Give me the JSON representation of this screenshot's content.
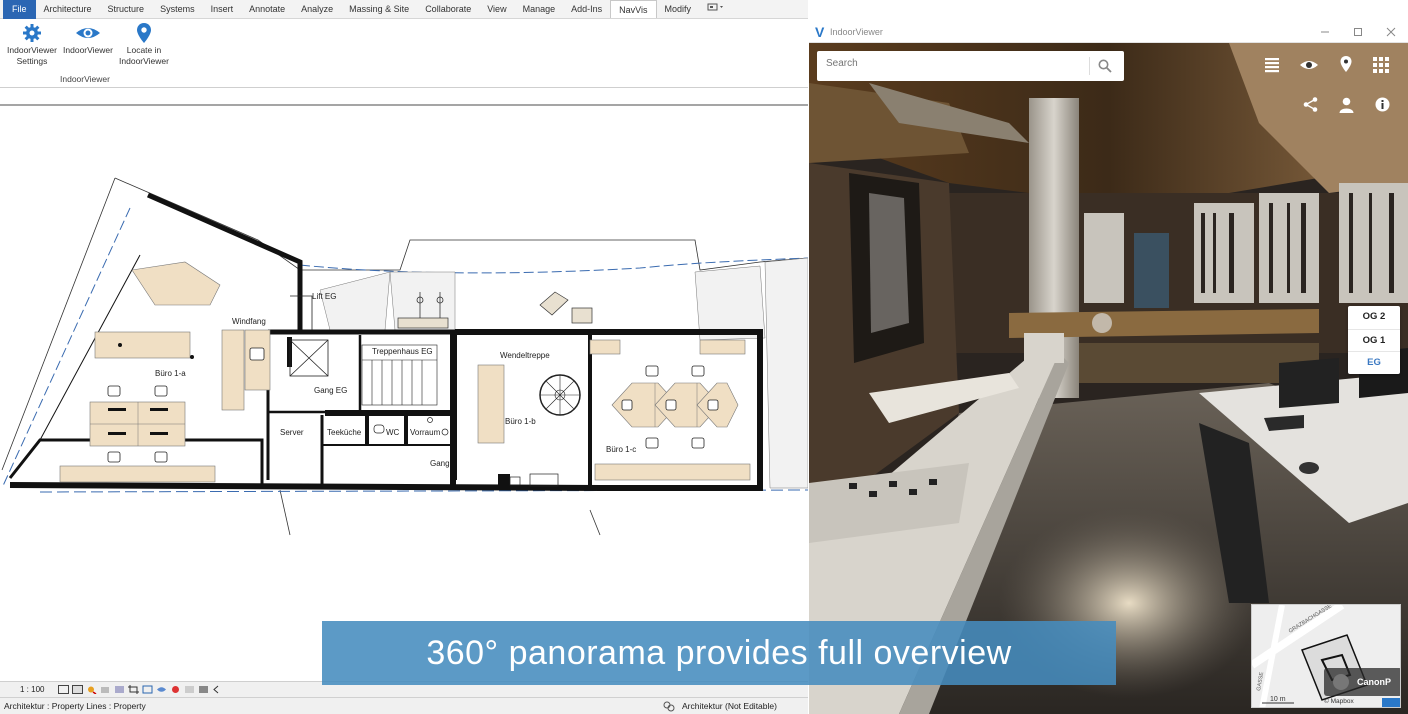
{
  "ribbon": {
    "tabs": [
      "File",
      "Architecture",
      "Structure",
      "Systems",
      "Insert",
      "Annotate",
      "Analyze",
      "Massing & Site",
      "Collaborate",
      "View",
      "Manage",
      "Add-Ins",
      "NavVis",
      "Modify"
    ],
    "active_tab": "NavVis",
    "buttons": {
      "settings": "IndoorViewer Settings",
      "viewer": "IndoorViewer",
      "locate": "Locate in IndoorViewer"
    },
    "group_label": "IndoorViewer"
  },
  "plan": {
    "rooms": {
      "lift": "Lift EG",
      "windfang": "Windfang",
      "treppenhaus": "Treppenhaus EG",
      "wendeltreppe": "Wendeltreppe",
      "buero1a": "Büro 1-a",
      "buero1b": "Büro 1-b",
      "buero1c": "Büro 1-c",
      "gang_eg": "Gang EG",
      "server": "Server",
      "teekueche": "Teeküche",
      "wc": "WC",
      "vorraum": "Vorraum",
      "gang": "Gang"
    }
  },
  "viewbar": {
    "scale": "1 : 100"
  },
  "status": {
    "left": "Architektur : Property Lines : Property",
    "right": "Architektur (Not Editable)"
  },
  "indoorviewer": {
    "title": "IndoorViewer",
    "logo": "V",
    "search_placeholder": "Search",
    "floors": [
      "OG 2",
      "OG 1",
      "EG"
    ],
    "active_floor": "EG",
    "minimap": {
      "street": "GRAZBACHGASSE",
      "street2": "GASSE",
      "scale": "10 m",
      "attribution": "© Mapbox",
      "canon": "CanonP"
    }
  },
  "caption": "360° panorama provides full overview",
  "colors": {
    "file_tab": "#2b66b3",
    "caption_bg": "#468cbe",
    "accent": "#3a78c2",
    "ribbon_icon": "#2a78c8"
  }
}
